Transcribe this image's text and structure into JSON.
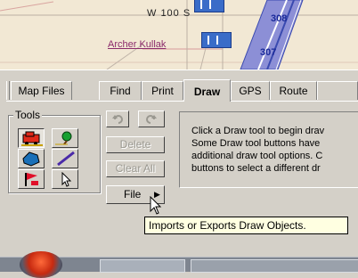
{
  "map": {
    "street_label": "W 100 S",
    "place_label": "Archer Kullak",
    "highway_labels": [
      "308",
      "307"
    ]
  },
  "tabs": [
    {
      "label": "Map Files",
      "active": false
    },
    {
      "label": "Find",
      "active": false
    },
    {
      "label": "Print",
      "active": false
    },
    {
      "label": "Draw",
      "active": true
    },
    {
      "label": "GPS",
      "active": false
    },
    {
      "label": "Route",
      "active": false
    }
  ],
  "tools": {
    "legend": "Tools",
    "icons": [
      "draw-car-icon",
      "draw-tree-icon",
      "draw-area-icon",
      "draw-line-icon",
      "draw-flag-icon",
      "select-arrow-icon"
    ]
  },
  "actions": {
    "undo_icon": "undo-icon",
    "redo_icon": "redo-icon",
    "delete_label": "Delete",
    "clear_all_label": "Clear All",
    "file_label": "File"
  },
  "info": {
    "lines": [
      "Click a Draw tool to begin drav",
      "Some Draw tool buttons have",
      "additional draw tool options. C",
      "buttons to select a different dr"
    ]
  },
  "tooltip": {
    "text": "Imports or Exports Draw Objects."
  },
  "colors": {
    "panel": "#d4d0c8",
    "map_bg": "#f2e8d4",
    "highway": "#3a4ab0",
    "tooltip_bg": "#ffffe1"
  }
}
